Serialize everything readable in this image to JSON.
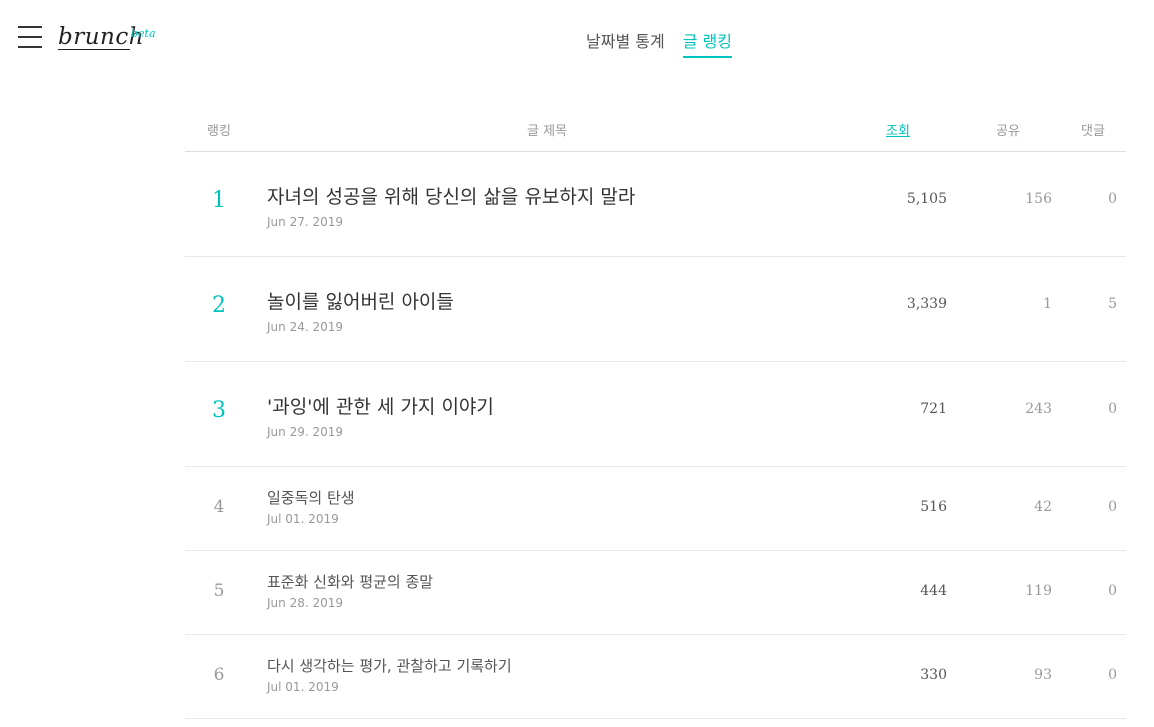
{
  "header": {
    "logo": "brunch",
    "logo_badge": "beta",
    "tabs": [
      {
        "label": "날짜별 통계",
        "active": false
      },
      {
        "label": "글 랭킹",
        "active": true
      }
    ]
  },
  "table": {
    "columns": {
      "rank": "랭킹",
      "title": "글 제목",
      "views": "조회",
      "shares": "공유",
      "comments": "댓글"
    },
    "rows": [
      {
        "rank": "1",
        "title": "자녀의 성공을 위해 당신의 삶을 유보하지 말라",
        "date": "Jun 27. 2019",
        "views": "5,105",
        "shares": "156",
        "comments": "0"
      },
      {
        "rank": "2",
        "title": "놀이를 잃어버린 아이들",
        "date": "Jun 24. 2019",
        "views": "3,339",
        "shares": "1",
        "comments": "5"
      },
      {
        "rank": "3",
        "title": "'과잉'에 관한 세 가지 이야기",
        "date": "Jun 29. 2019",
        "views": "721",
        "shares": "243",
        "comments": "0"
      },
      {
        "rank": "4",
        "title": "일중독의 탄생",
        "date": "Jul 01. 2019",
        "views": "516",
        "shares": "42",
        "comments": "0"
      },
      {
        "rank": "5",
        "title": "표준화 신화와 평균의 종말",
        "date": "Jun 28. 2019",
        "views": "444",
        "shares": "119",
        "comments": "0"
      },
      {
        "rank": "6",
        "title": "다시 생각하는 평가, 관찰하고 기록하기",
        "date": "Jul 01. 2019",
        "views": "330",
        "shares": "93",
        "comments": "0"
      }
    ]
  },
  "colors": {
    "accent": "#00c3bd",
    "text": "#333333",
    "muted": "#999999",
    "divider": "#e8e8e8"
  }
}
